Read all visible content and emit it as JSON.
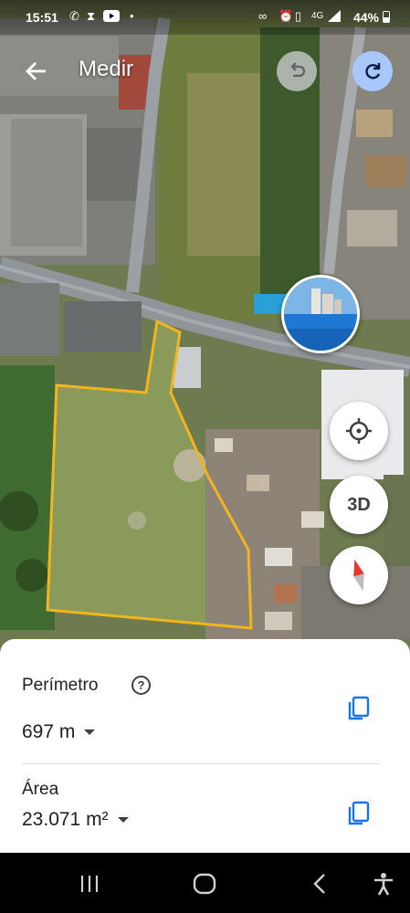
{
  "status_bar": {
    "time": "15:51",
    "battery": "44%",
    "left_icons": [
      "whatsapp-icon",
      "hourglass-icon",
      "youtube-icon",
      "dot-icon"
    ],
    "right_icons": [
      "link-icon",
      "alarm-icon",
      "vibrate-icon",
      "4g-signal-icon",
      "signal-icon"
    ]
  },
  "header": {
    "title": "Medir",
    "back_icon": "arrow-left-icon",
    "undo_icon": "undo-icon",
    "redo_icon": "redo-icon",
    "redo_color": "#a8c7fa"
  },
  "map": {
    "measure_polygon_color": "#f2b51d",
    "buttons": {
      "location_icon": "crosshair-icon",
      "three_d_label": "3D",
      "compass_icon": "compass-icon"
    }
  },
  "measurement": {
    "perimeter_label": "Perímetro",
    "perimeter_value": "697 m",
    "area_label": "Área",
    "area_value": "23.071 m²",
    "copy_icon": "copy-icon",
    "help_icon": "help-icon",
    "accent_color": "#1a73e8"
  },
  "nav_bar": {
    "icons": [
      "recents-icon",
      "home-icon",
      "back-icon",
      "accessibility-icon"
    ]
  }
}
